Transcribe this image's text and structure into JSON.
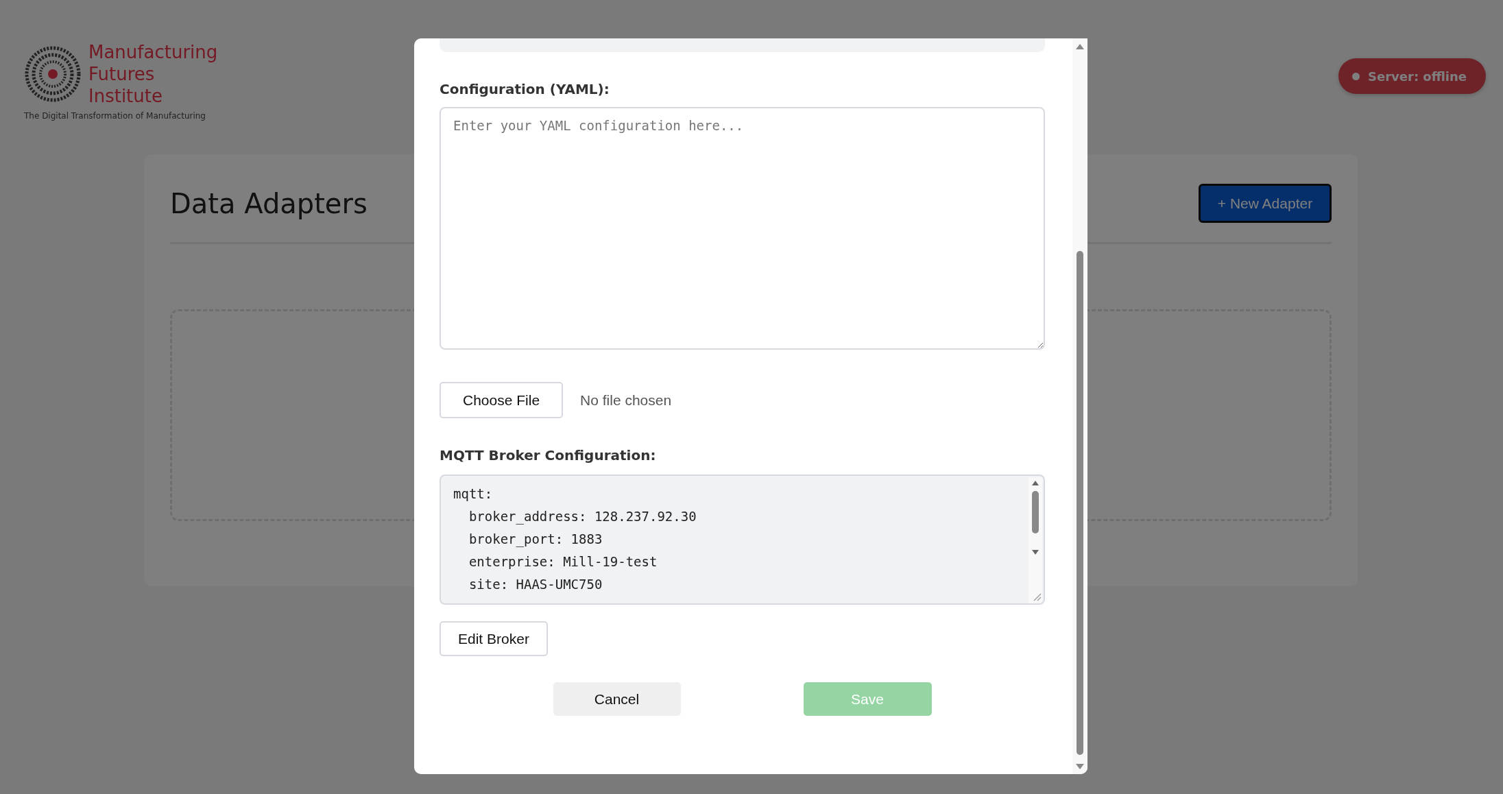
{
  "header": {
    "logo": {
      "name_lines": [
        "Manufacturing",
        "Futures",
        "Institute"
      ],
      "tagline": "The Digital Transformation of Manufacturing"
    },
    "server_status": {
      "label": "Server: offline",
      "online": false
    }
  },
  "page": {
    "title": "Data Adapters",
    "new_button": "+ New Adapter"
  },
  "modal": {
    "yaml_label": "Configuration (YAML):",
    "yaml_placeholder": "Enter your YAML configuration here...",
    "file_button": "Choose File",
    "file_status": "No file chosen",
    "broker_label": "MQTT Broker Configuration:",
    "broker_lines": [
      "mqtt:",
      "  broker_address: 128.237.92.30",
      "  broker_port: 1883",
      "  enterprise: Mill-19-test",
      "  site: HAAS-UMC750"
    ],
    "edit_button": "Edit Broker",
    "cancel_button": "Cancel",
    "save_button": "Save",
    "save_disabled": true
  }
}
